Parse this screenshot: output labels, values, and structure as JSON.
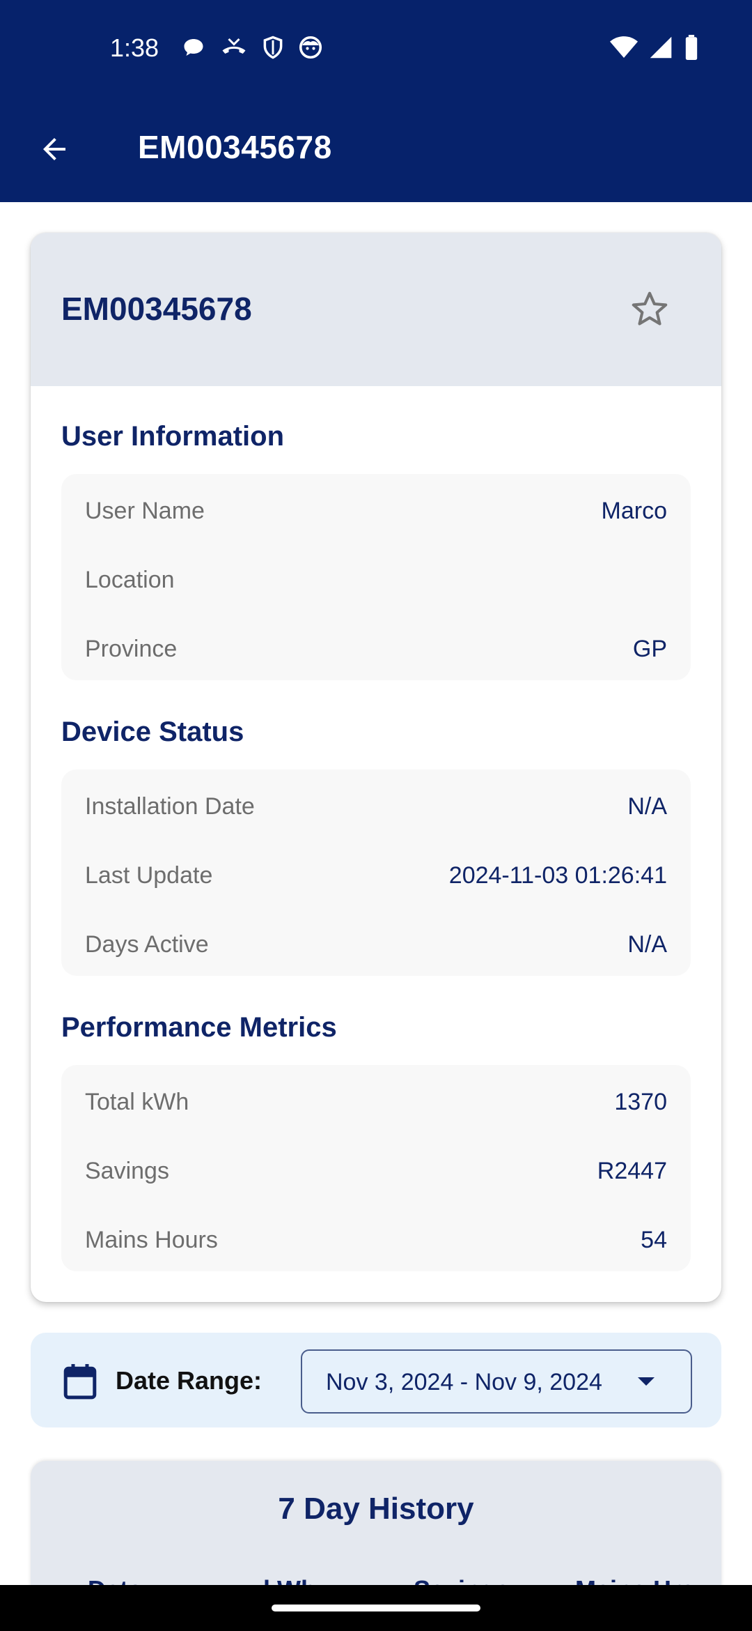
{
  "status_bar": {
    "time": "1:38",
    "left_icons": [
      "chat-bubble-icon",
      "missed-call-icon",
      "shield-icon",
      "face-icon"
    ],
    "right_icons": [
      "wifi-icon",
      "signal-icon",
      "battery-icon"
    ]
  },
  "app_bar": {
    "title": "EM00345678",
    "back_icon": "arrow-left-icon"
  },
  "device_card": {
    "title": "EM00345678",
    "favorite_icon": "star-outline-icon",
    "sections": [
      {
        "title": "User Information",
        "rows": [
          {
            "label": "User Name",
            "value": "Marco"
          },
          {
            "label": "Location",
            "value": ""
          },
          {
            "label": "Province",
            "value": "GP"
          }
        ]
      },
      {
        "title": "Device Status",
        "rows": [
          {
            "label": "Installation Date",
            "value": "N/A"
          },
          {
            "label": "Last Update",
            "value": "2024-11-03 01:26:41"
          },
          {
            "label": "Days Active",
            "value": "N/A"
          }
        ]
      },
      {
        "title": "Performance Metrics",
        "rows": [
          {
            "label": "Total kWh",
            "value": "1370"
          },
          {
            "label": "Savings",
            "value": "R2447"
          },
          {
            "label": "Mains Hours",
            "value": "54"
          }
        ]
      }
    ]
  },
  "date_range": {
    "label": "Date Range:",
    "selected": "Nov 3, 2024 - Nov 9, 2024",
    "icon": "calendar-icon"
  },
  "history": {
    "title": "7 Day History",
    "columns": [
      "Date",
      "kWh",
      "Savings",
      "Mains Hrs"
    ]
  },
  "colors": {
    "primary": "#06226b",
    "text_dark": "#0f2467",
    "header_bg": "#e4e8ef",
    "date_bar_bg": "#e6f1fb"
  }
}
